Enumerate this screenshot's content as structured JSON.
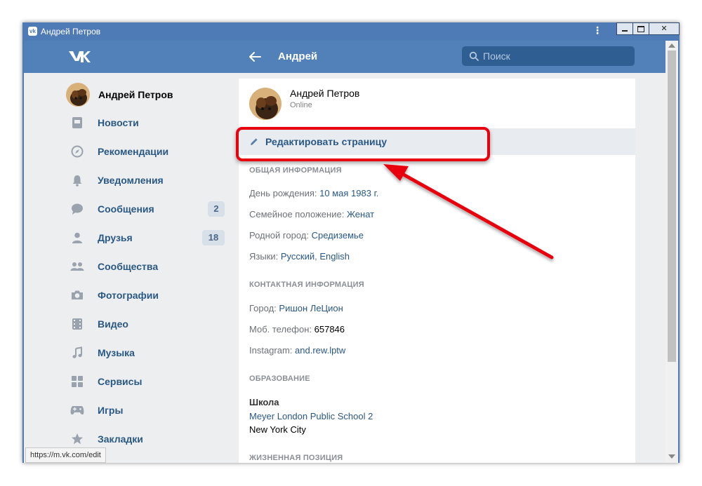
{
  "window": {
    "title": "Андрей Петров"
  },
  "header": {
    "title": "Андрей",
    "search_placeholder": "Поиск"
  },
  "sidebar": {
    "profile_name": "Андрей Петров",
    "items": [
      {
        "label": "Новости",
        "icon": "news-icon"
      },
      {
        "label": "Рекомендации",
        "icon": "compass-icon"
      },
      {
        "label": "Уведомления",
        "icon": "bell-icon"
      },
      {
        "label": "Сообщения",
        "icon": "message-icon",
        "badge": "2"
      },
      {
        "label": "Друзья",
        "icon": "person-icon",
        "badge": "18"
      },
      {
        "label": "Сообщества",
        "icon": "group-icon"
      },
      {
        "label": "Фотографии",
        "icon": "camera-icon"
      },
      {
        "label": "Видео",
        "icon": "film-icon"
      },
      {
        "label": "Музыка",
        "icon": "music-note-icon"
      },
      {
        "label": "Сервисы",
        "icon": "grid-icon"
      },
      {
        "label": "Игры",
        "icon": "gamepad-icon"
      },
      {
        "label": "Закладки",
        "icon": "star-icon"
      }
    ]
  },
  "profile": {
    "name": "Андрей Петров",
    "status": "Online",
    "edit_label": "Редактировать страницу"
  },
  "sections": {
    "general": "ОБЩАЯ ИНФОРМАЦИЯ",
    "contact": "КОНТАКТНАЯ ИНФОРМАЦИЯ",
    "education": "ОБРАЗОВАНИЕ",
    "life": "ЖИЗНЕННАЯ ПОЗИЦИЯ"
  },
  "general": {
    "birthday_label": "День рождения:",
    "birthday_value": "10 мая 1983 г.",
    "marital_label": "Семейное положение:",
    "marital_value": "Женат",
    "hometown_label": "Родной город:",
    "hometown_value": "Средиземье",
    "languages_label": "Языки:",
    "language_1": "Русский",
    "language_sep": ", ",
    "language_2": "English"
  },
  "contact": {
    "city_label": "Город:",
    "city_value": "Ришон ЛеЦион",
    "phone_label": "Моб. телефон:",
    "phone_value": "657846",
    "instagram_label": "Instagram:",
    "instagram_value": "and.rew.lptw"
  },
  "education": {
    "school_heading": "Школа",
    "school_name": "Meyer London Public School 2",
    "school_city": "New York City"
  },
  "statusbar": {
    "url": "https://m.vk.com/edit"
  },
  "colors": {
    "header": "#5181b8",
    "link": "#2a5885",
    "highlight": "#e8000f"
  }
}
